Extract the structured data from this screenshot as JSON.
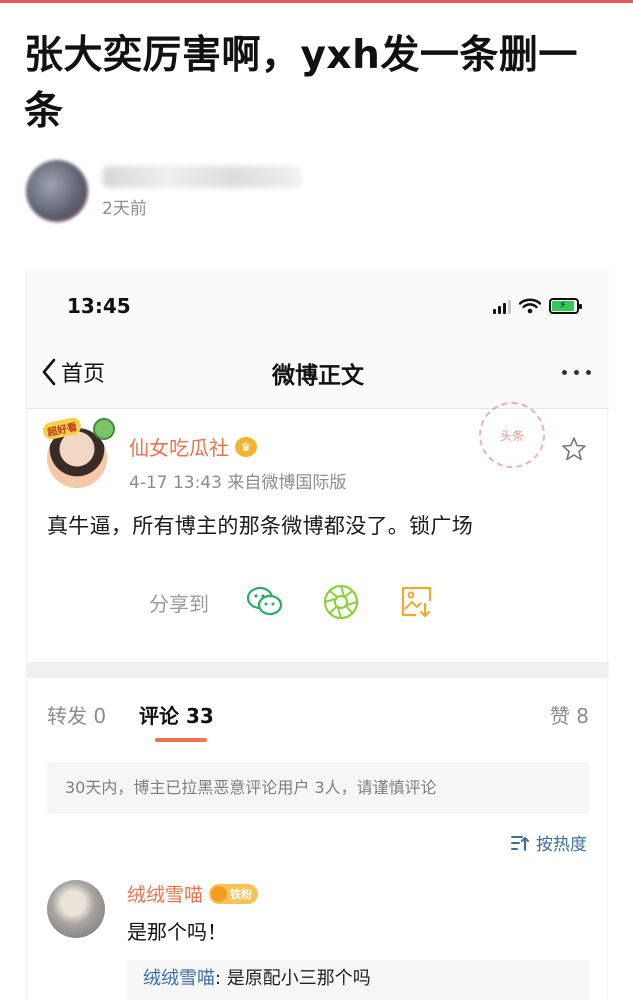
{
  "article": {
    "title": "张大奕厉害啊，yxh发一条删一条",
    "time": "2天前"
  },
  "phone": {
    "status_time": "13:45",
    "battery_level": 0.9,
    "battery_color": "#35c759",
    "nav": {
      "back_label": "首页",
      "title": "微博正文"
    },
    "stamp_text": "头条"
  },
  "post": {
    "author": "仙女吃瓜社",
    "meta": "4-17 13:43  来自微博国际版",
    "body": "真牛逼，所有博主的那条微博都没了。锁广场",
    "share_label": "分享到",
    "icons": [
      "wechat-icon",
      "moments-icon",
      "save-image-icon"
    ]
  },
  "tabs": {
    "repost": "转发 0",
    "comments": "评论 33",
    "likes": "赞 8"
  },
  "notice": "30天内，博主已拉黑恶意评论用户 3人，请谨慎评论",
  "sort_label": "按热度",
  "comment": {
    "author": "绒绒雪喵",
    "badge": "铁粉",
    "text": "是那个吗！",
    "reply_author": "绒绒雪喵",
    "reply_text": ": 是原配小三那个吗"
  },
  "colors": {
    "accent": "#eb7350",
    "link": "#3d6f9e",
    "wechat_green": "#2aae67",
    "moments_green": "#8ccf3f",
    "save_orange": "#f0a830"
  }
}
